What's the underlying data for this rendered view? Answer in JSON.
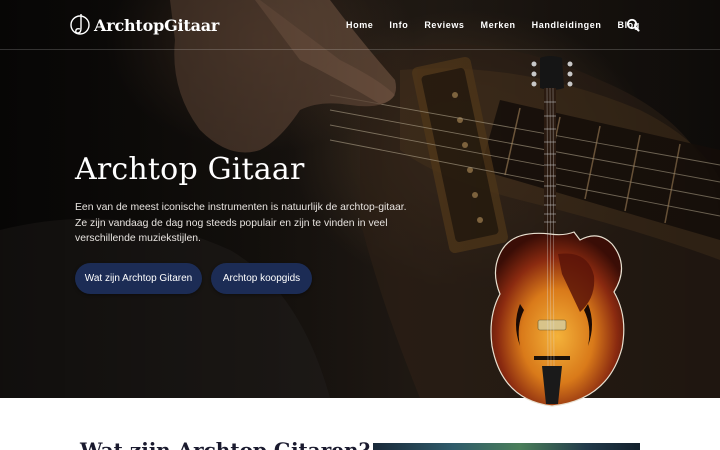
{
  "header": {
    "logo_text": "ArchtopGitaar",
    "nav": [
      "Home",
      "Info",
      "Reviews",
      "Merken",
      "Handleidingen",
      "Blog"
    ]
  },
  "hero": {
    "title": "Archtop Gitaar",
    "description_lines": [
      "Een van de meest iconische instrumenten is natuurlijk de archtop-gitaar.",
      "Ze zijn vandaag de dag nog steeds populair en zijn te vinden in veel",
      "verschillende muziekstijlen."
    ],
    "buttons": [
      "Wat zijn Archtop Gitaren",
      "Archtop koopgids"
    ]
  },
  "section": {
    "heading": "Wat zijn Archtop Gitaren?"
  },
  "colors": {
    "button_bg": "#1c2c55",
    "text_light": "#ffffff",
    "heading_dark": "#1a1a2e"
  },
  "icons": [
    "guitar-logo-icon",
    "search-icon"
  ]
}
